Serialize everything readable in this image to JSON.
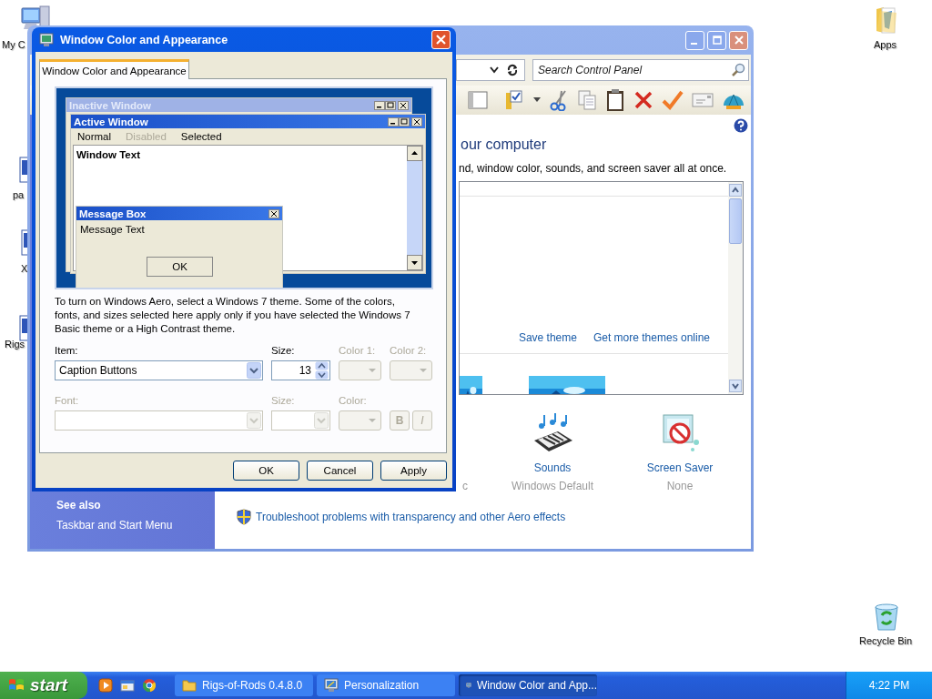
{
  "desktop_icons": [
    {
      "label": "My C",
      "kind": "computer"
    },
    {
      "label": "pa",
      "kind": "document"
    },
    {
      "label": "X",
      "kind": "document"
    },
    {
      "label": "Rigs",
      "kind": "document"
    },
    {
      "label": "Apps",
      "kind": "folder"
    },
    {
      "label": "Recycle Bin",
      "kind": "recycle"
    }
  ],
  "window": {
    "search": {
      "placeholder": "Search Control Panel"
    },
    "heading": "our computer",
    "subtext": "nd, window color, sounds, and screen saver all at once.",
    "theme_links": [
      "Save theme",
      "Get more themes online"
    ],
    "themes": [
      {
        "kind": "picture"
      },
      {
        "kind": "picture"
      }
    ],
    "cut_caption": "c",
    "settings": [
      {
        "kind": "sounds",
        "label": "Sounds",
        "value": "Windows Default"
      },
      {
        "kind": "screensaver",
        "label": "Screen Saver",
        "value": "None"
      }
    ],
    "troubleshoot": "Troubleshoot problems with transparency and other Aero effects",
    "see_also": {
      "title": "See also",
      "links": [
        "Taskbar and Start Menu"
      ]
    }
  },
  "dialog": {
    "title": "Window Color and Appearance",
    "tabs": [
      {
        "label": "Window Color and Appearance",
        "selected": true
      }
    ],
    "preview": {
      "inactive_title": "Inactive Window",
      "active_title": "Active Window",
      "menu": [
        {
          "label": "Normal",
          "disabled": false
        },
        {
          "label": "Disabled",
          "disabled": true
        },
        {
          "label": "Selected",
          "disabled": false
        }
      ],
      "window_text": "Window Text",
      "message_box": {
        "title": "Message Box",
        "text": "Message Text",
        "button": "OK"
      }
    },
    "description": "To turn on Windows Aero, select a Windows 7 theme.  Some of the colors, fonts, and sizes selected here apply only if you have selected the Windows 7 Basic theme or a High Contrast theme.",
    "fields": [
      {
        "label": "Item:",
        "kind": "dropdown",
        "value": "Caption Buttons",
        "disabled": false
      },
      {
        "label": "Size:",
        "kind": "spin",
        "value": "13",
        "disabled": false
      },
      {
        "label": "Color 1:",
        "kind": "color",
        "disabled": true
      },
      {
        "label": "Color 2:",
        "kind": "color",
        "disabled": true
      }
    ],
    "font_fields": [
      {
        "label": "Font:",
        "kind": "dropdown",
        "disabled": true
      },
      {
        "label": "Size:",
        "kind": "dropdown",
        "disabled": true
      },
      {
        "label": "Color:",
        "kind": "color",
        "disabled": true
      }
    ],
    "style_buttons": [
      {
        "label": "B",
        "kind": "bold",
        "disabled": true
      },
      {
        "label": "I",
        "kind": "italic",
        "disabled": true
      }
    ],
    "buttons": [
      "OK",
      "Cancel",
      "Apply"
    ]
  },
  "taskbar": {
    "start": "start",
    "tasks": [
      {
        "label": "Rigs-of-Rods 0.4.8.0",
        "kind": "folder",
        "selected": false
      },
      {
        "label": "Personalization",
        "kind": "monitor",
        "selected": false
      },
      {
        "label": "Window Color and App...",
        "kind": "monitor",
        "selected": true
      }
    ],
    "clock": "4:22 PM"
  }
}
